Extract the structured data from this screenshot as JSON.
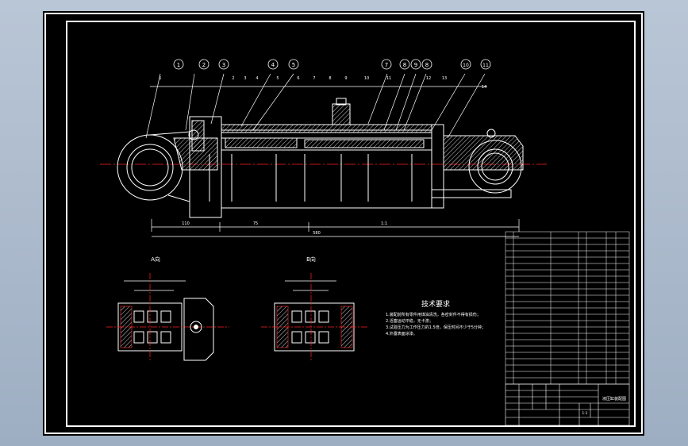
{
  "drawing": {
    "view_a_label": "A向",
    "view_b_label": "B向",
    "tech_title": "技术要求",
    "tech_notes": [
      "1.装配前所有零件用煤油清洗，各密封件不得有损伤；",
      "2.活塞运动平稳，无卡滞；",
      "3.试验压力为工作压力的1.5倍，保压时间不少于5分钟；",
      "4.外露表面涂漆。"
    ],
    "dim_left": "110",
    "dim_mid": "75",
    "dim_right": "1:1",
    "dim_total": "580",
    "balloons": [
      "1",
      "2",
      "3",
      "4",
      "5",
      "7",
      "8",
      "9",
      "8",
      "10",
      "11"
    ],
    "leader_numbers": [
      "1",
      "2",
      "3",
      "4",
      "5",
      "6",
      "7",
      "8",
      "9",
      "10",
      "11",
      "12",
      "13",
      "14"
    ]
  },
  "title_block": {
    "drawing_name": "液压缸装配图",
    "scale": "1:1"
  }
}
